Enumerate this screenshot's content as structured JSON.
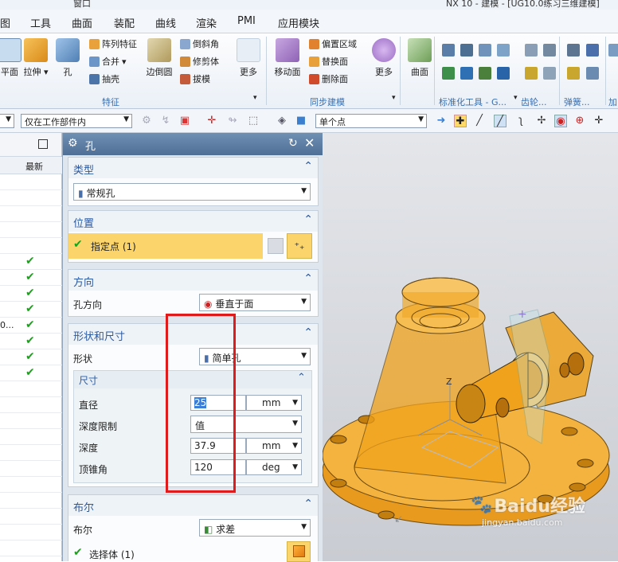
{
  "titlebar": {
    "window_menu": "窗口",
    "app_title": "NX 10 - 建模 - [UG10.0练习三维建模]"
  },
  "menubar": {
    "items": [
      "图",
      "工具",
      "曲面",
      "装配",
      "曲线",
      "渲染",
      "PMI",
      "应用模块"
    ]
  },
  "ribbon": {
    "feature_group": {
      "label": "特征",
      "big": [
        "平面",
        "拉伸",
        "孔",
        "边倒圆",
        "更多"
      ],
      "small": [
        "阵列特征",
        "合并",
        "抽壳",
        "倒斜角",
        "修剪体",
        "拔模"
      ]
    },
    "sync_group": {
      "label": "同步建模",
      "big": [
        "移动面",
        "更多"
      ],
      "small": [
        "偏置区域",
        "替换面",
        "删除面"
      ]
    },
    "surface": {
      "big": [
        "曲面"
      ]
    },
    "std_tools_label": "标准化工具 - G...",
    "gear_label": "齿轮...",
    "spring_label": "弹簧...",
    "add_label": "加"
  },
  "toolbar": {
    "scope_combo": "仅在工作部件内",
    "snap_combo": "单个点"
  },
  "navigator": {
    "column_latest": "最新",
    "row_fragment": "0..."
  },
  "dialog": {
    "title": "孔",
    "type": {
      "title": "类型",
      "value": "常规孔"
    },
    "position": {
      "title": "位置",
      "specify_point": "指定点 (1)"
    },
    "direction": {
      "title": "方向",
      "label": "孔方向",
      "value": "垂直于面"
    },
    "shape": {
      "title": "形状和尺寸",
      "shape_label": "形状",
      "shape_value": "简单孔",
      "dims_title": "尺寸",
      "diameter_label": "直径",
      "diameter_value": "25",
      "diameter_unit": "mm",
      "depth_limit_label": "深度限制",
      "depth_limit_value": "值",
      "depth_label": "深度",
      "depth_value": "37.9",
      "depth_unit": "mm",
      "tip_angle_label": "顶锥角",
      "tip_angle_value": "120",
      "tip_angle_unit": "deg"
    },
    "boolean": {
      "title": "布尔",
      "label": "布尔",
      "value": "求差",
      "select_body": "选择体 (1)"
    }
  },
  "watermark": {
    "brand": "Baidu经验",
    "url": "jingyan.baidu.com"
  },
  "colors": {
    "model_orange": "#f0a21c",
    "accent_blue": "#2c5aa0",
    "highlight_red": "#e01b1b"
  }
}
